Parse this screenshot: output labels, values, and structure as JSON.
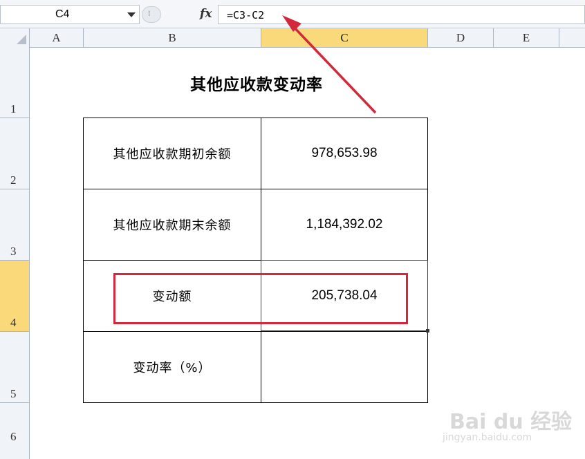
{
  "formula_bar": {
    "name_box": "C4",
    "fx_label": "fx",
    "formula": "=C3-C2"
  },
  "columns": [
    "A",
    "B",
    "C",
    "D",
    "E"
  ],
  "rows": [
    "1",
    "2",
    "3",
    "4",
    "5",
    "6"
  ],
  "selected_column": "C",
  "selected_row": "4",
  "sheet": {
    "title": "其他应收款变动率",
    "table": [
      {
        "label": "其他应收款期初余额",
        "value": "978,653.98"
      },
      {
        "label": "其他应收款期末余额",
        "value": "1,184,392.02"
      },
      {
        "label": "变动额",
        "value": "205,738.04"
      },
      {
        "label": "变动率（%）",
        "value": ""
      }
    ]
  },
  "annotation": {
    "highlight_color": "#d1283b",
    "arrow_color": "#d1283b"
  },
  "watermark": {
    "brand": "Bai du 经验",
    "url": "jingyan.baidu.com"
  }
}
